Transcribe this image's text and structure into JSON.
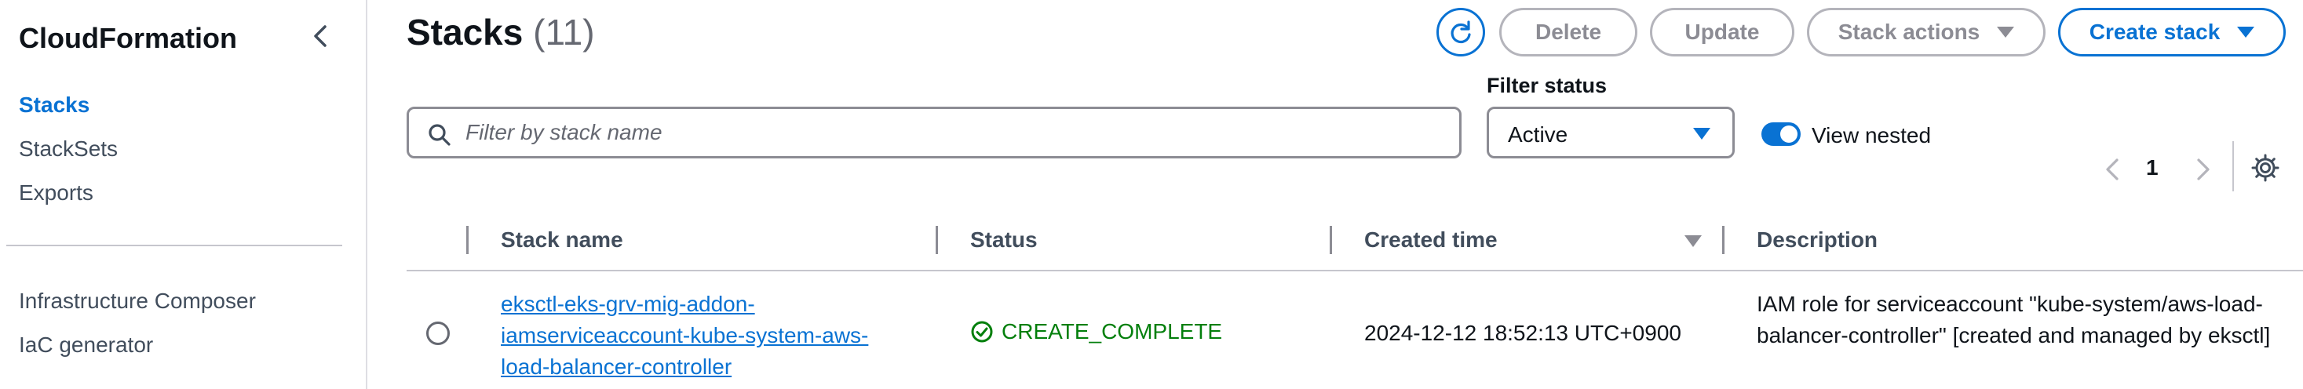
{
  "sidebar": {
    "title": "CloudFormation",
    "items": [
      {
        "label": "Stacks",
        "active": true
      },
      {
        "label": "StackSets"
      },
      {
        "label": "Exports"
      },
      {
        "label": "Infrastructure Composer"
      },
      {
        "label": "IaC generator"
      }
    ],
    "collapse_icon": "chevron-left-icon"
  },
  "header": {
    "title": "Stacks",
    "count": "(11)",
    "buttons": {
      "refresh_icon": "refresh-icon",
      "delete": "Delete",
      "update": "Update",
      "stack_actions": "Stack actions",
      "create_stack": "Create stack"
    }
  },
  "filters": {
    "search_placeholder": "Filter by stack name",
    "search_value": "",
    "status_label": "Filter status",
    "status_value": "Active",
    "view_nested_label": "View nested",
    "view_nested_on": true
  },
  "pagination": {
    "current_page": "1"
  },
  "table": {
    "columns": [
      "Stack name",
      "Status",
      "Created time",
      "Description"
    ],
    "sorted_column": "Created time",
    "rows": [
      {
        "stack_name": "eksctl-eks-grv-mig-addon-iamserviceaccount-kube-system-aws-load-balancer-controller",
        "status": "CREATE_COMPLETE",
        "created_time": "2024-12-12 18:52:13 UTC+0900",
        "description": "IAM role for serviceaccount \"kube-system/aws-load-balancer-controller\" [created and managed by eksctl]"
      }
    ]
  },
  "colors": {
    "accent": "#0972d3",
    "success": "#037f0c",
    "disabled": "#8c8c94",
    "text": "#0f141a"
  }
}
